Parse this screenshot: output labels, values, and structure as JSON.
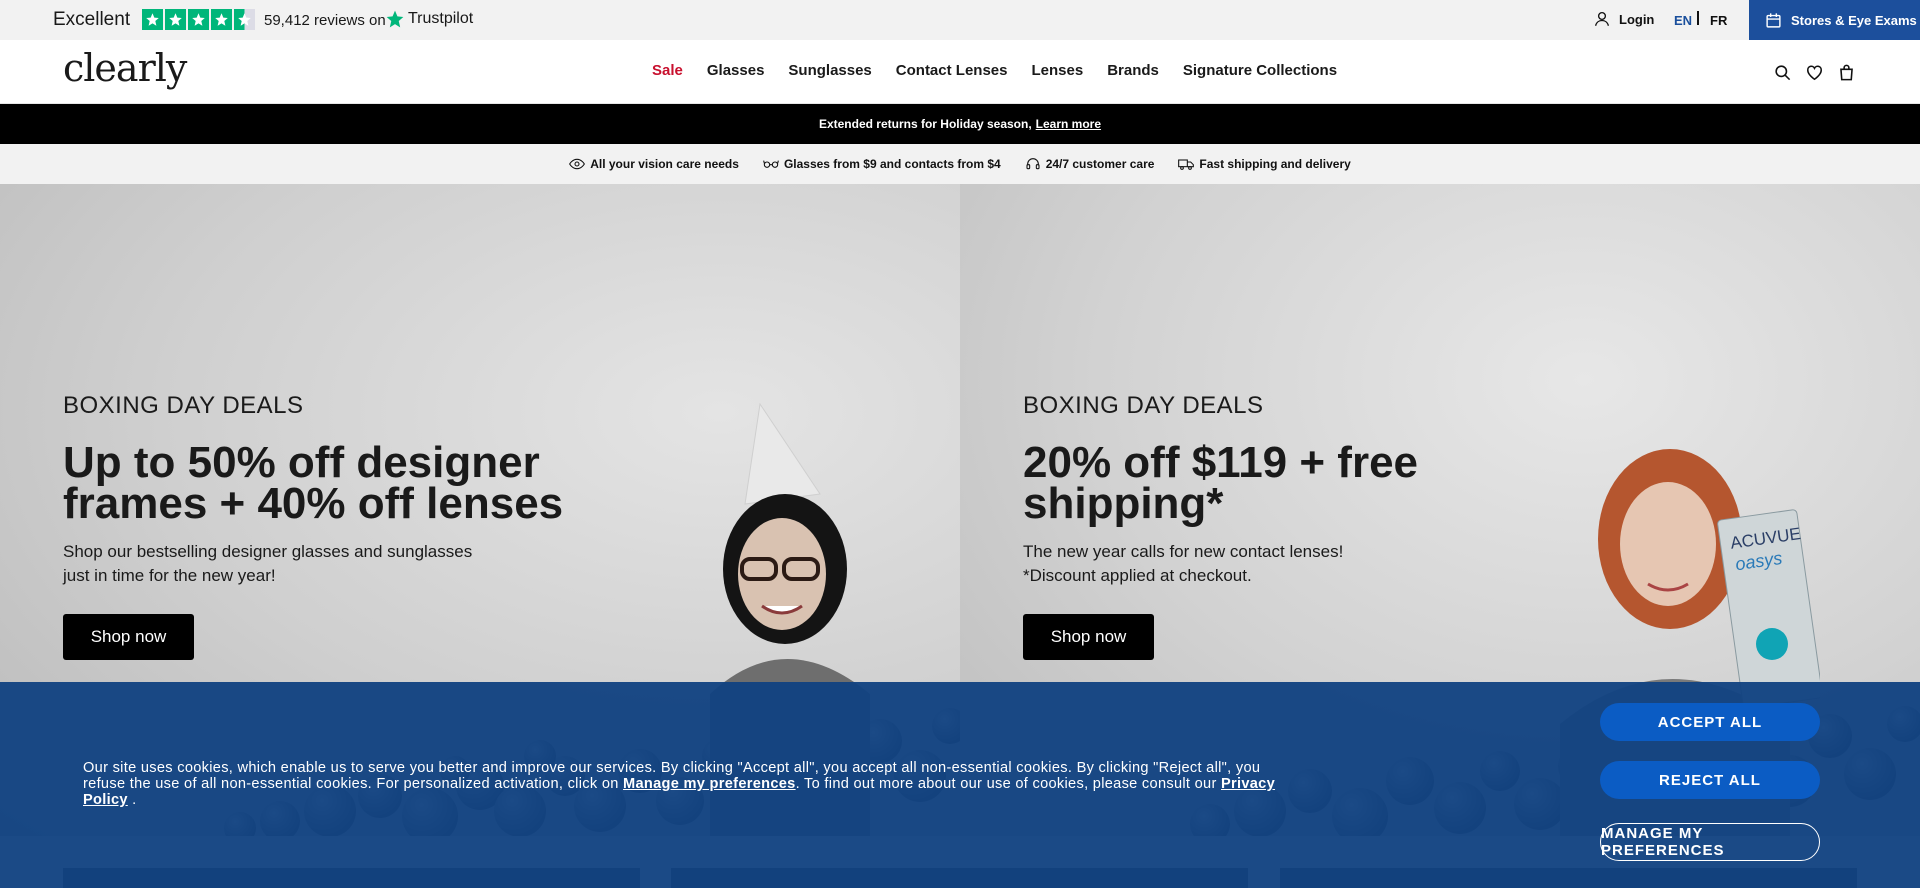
{
  "trustbar": {
    "rating_word": "Excellent",
    "stars": 4.5,
    "reviews_text": "59,412 reviews on",
    "brand": "Trustpilot",
    "brand_color": "#00b67a"
  },
  "account": {
    "login_label": "Login"
  },
  "language": {
    "en": "EN",
    "fr": "FR",
    "active": "EN"
  },
  "stores_button": {
    "label": "Stores & Eye Exams",
    "color": "#1c4f9c"
  },
  "header": {
    "logo": "clearly",
    "nav": [
      "Sale",
      "Glasses",
      "Sunglasses",
      "Contact Lenses",
      "Lenses",
      "Brands",
      "Signature Collections"
    ],
    "sale_color": "#c8102e",
    "icons": [
      "search-icon",
      "heart-icon",
      "bag-icon"
    ]
  },
  "promo": {
    "text": "Extended returns for Holiday season,",
    "link": "Learn more"
  },
  "features": [
    {
      "icon": "eye-icon",
      "label": "All your vision care needs"
    },
    {
      "icon": "glasses-icon",
      "label": "Glasses from $9 and contacts from $4"
    },
    {
      "icon": "headset-icon",
      "label": "24/7 customer care"
    },
    {
      "icon": "truck-icon",
      "label": "Fast shipping and delivery"
    }
  ],
  "heroes": [
    {
      "eyebrow": "BOXING DAY DEALS",
      "headline_1": "Up to 50% off designer",
      "headline_2": "frames + 40% off lenses",
      "sub_1": "Shop our bestselling designer glasses and sunglasses",
      "sub_2": "just in time for the new year!",
      "cta": "Shop now"
    },
    {
      "eyebrow": "BOXING DAY DEALS",
      "headline_1": "20% off $119 + free",
      "headline_2": "shipping*",
      "sub_1": "The new year calls for new contact lenses!",
      "sub_2": "*Discount applied at checkout.",
      "cta": "Shop now",
      "product_text_1": "ACUVUE",
      "product_text_2": "oasys"
    }
  ],
  "cookie": {
    "text_1": "Our site uses cookies, which enable us to serve you better and improve our services. By clicking \"Accept all\", you accept all non-essential cookies. By clicking \"Reject all\", you refuse the use of all non-essential cookies. For personalized activation, click on ",
    "link_preferences": "Manage my preferences",
    "text_2": ". To find out more about our use of cookies, please consult our ",
    "link_privacy": "Privacy Policy",
    "text_3": " .",
    "accept": "ACCEPT ALL",
    "reject": "REJECT ALL",
    "manage": "MANAGE MY PREFERENCES",
    "background": "#124381",
    "button_color": "#0b5cc4"
  }
}
